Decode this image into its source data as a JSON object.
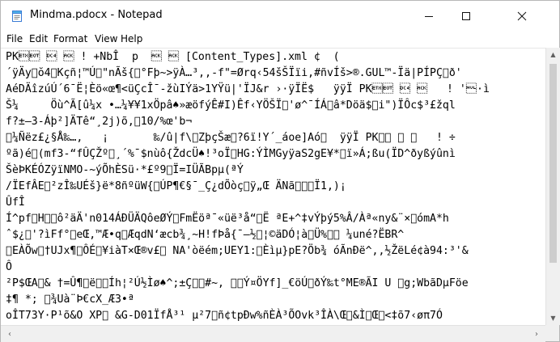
{
  "window": {
    "title": "Mindma.pdocx - Notepad",
    "buttons": {
      "minimize": "—",
      "maximize": "☐",
      "close": "✕"
    }
  },
  "menu": [
    "File",
    "Edit",
    "Format",
    "View",
    "Help"
  ],
  "editor": {
    "lines": [
      "PK\u0003\u0004 \u0014 \u0006 ! +NbÎ  p  \u0006 \u0006 [Content_Types].xml ¢  (",
      "´ÿÄy\u0000ŏ4\u0000Kçñ¦™Ú\u0000\"nÃš{\u0000°Fþ~>ÿÀ…³,,-f\"=Ørq‹54šŠÏïi,#ñvÍš>®.GUL™-Ïä|PÍPÇ\u0000ð'",
      "AéDÄîzúÚ´6¯Ë¦Èö«œ¶<üÇcÎ¯-žùIÝä>1YŸü|'ÏJ&r ›·ÿÏË$   ÿÿÏ PK\u0003\u0004 \u0014 \u0006   ! '\u0000·ì",
      "Š¼     Öù^Ã[û¼x •…¼¥¥1xÖpâ♠»æöfýÊ#I)Êf‹YÖŠÏ\u0000'ø^¯ÍÁ\u0000â*Döä$\u0000i\")ÏÔc$³£žql",
      "f?±—3-Áþ²]ÄTê“¸2j)õ,\u000010/%œ'b¬",
      "\u0000¼Ñëz£¿§Å‰…,   ¡       ‰/û|f\\\u0000ZþçŠæ\u0000?6ï!Y´_áo\fe]Aó\u0000  ÿÿÏ PK\u0003\u0004 \u0014 \u0006   ! ÷",
      "ºã)é\u0000(mf3-“fÛÇŽº\u0000¸´%¯$nùô{ŽdcÜ♠!³oÏ\u0000HG:ÝÌMGyÿaS2gE¥*\u0000ï»Á;ßu(ÏD^ðyßýûnì",
      "ŠèÞKÉÓZÿïNMO-~ýÕhÈSü·*£º9\u0000Ï=IÜÃBpµ(ªÝ",
      "/ÏEfÂE\u0000²zÎ‰UÉš}ë*8ñºüW{\u0000ÚP¶€§¯_Ç¿dÕòç\u0000ÿ„Œ ÄNã\u0000\u0000\u0000Ï1,)¡",
      "ÛfÎ",
      "Í^pf\u0000H\u0000\u0000ô²äÄ'n014ÁÐÜÄQôeØÝ\u0000FmËöª¯«üë³å“\u0000Ë ªE+^‡vÝþý5%Â/Àª«ny&¨×\u0000ómA*h",
      "ˆ$¿\u0000'?ìFf°\u0000eŒ,™Æ•q\u0000ÆqdN‘æcb¾¸~H!fÞå{¯–½\u0000¦©äDÓ¦à\u0000Ü%\u0000\u0000 ¼uné?ËBR^",
      "\u0000EÀÕw\u0000†UJx¶\u0000ÔÉ\u0000¥iàT×Œ®v£\u0000 NA'òëém;UEY1:\u0000Èìµ}pE?Öb¾ óÃnÐë^,,½ŽëLé¢à94:³'&",
      "Ô",
      "²P$ŒA\u0000& †=Û¶\u0000ë\u0000\u0000Íh¦²Ú½Ìø♠^;±Ç\u0000\u0000#~, \u0000\u0000Ý¤ÖYf]_€öÚ\u0000ðÝ‰t°ME®ÃI U \u0000g;WbãDµFöe",
      "‡¶ *; \u0000¾Uà¨Þ€cX_Æ3•ª",
      "oÎT73Y·P¹õ&O XP\u0000 &G-D01ÏfÅ³¹ µ²7\u0000ñ¢tpÐw%ñÈÀ³ÕOvk³ÎÀ\\Œ\u0000&Ì\u0000Œ\u0000<‡õ7‹øπ7Ó"
    ]
  }
}
